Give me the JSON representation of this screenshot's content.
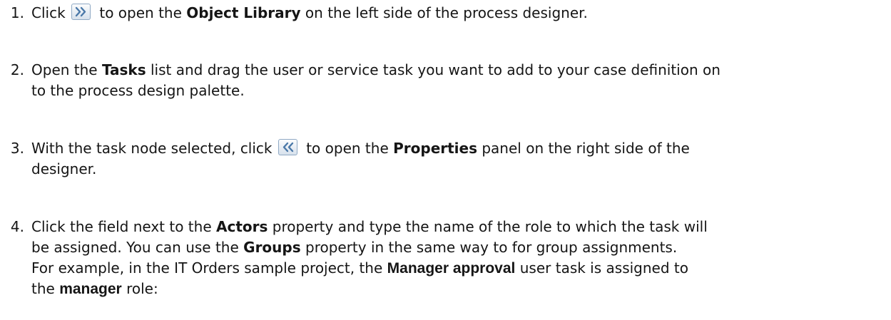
{
  "steps": [
    {
      "number": "1.",
      "lines": [
        {
          "a": "Click ",
          "b": " to open the ",
          "bold": "Object Library",
          "c": " on the left side of the process designer."
        }
      ],
      "icon": "expand-right-double-chevron-icon"
    },
    {
      "number": "2.",
      "lines": [
        {
          "a": "Open the ",
          "bold": "Tasks",
          "c": " list and drag the user or service task you want to add to your case definition on"
        },
        {
          "a": "to the process design palette."
        }
      ]
    },
    {
      "number": "3.",
      "lines": [
        {
          "a": "With the task node selected, click ",
          "b": " to open the ",
          "bold": "Properties",
          "c": " panel on the right side of the"
        },
        {
          "a": "designer."
        }
      ],
      "icon": "collapse-left-double-chevron-icon"
    },
    {
      "number": "4.",
      "lines": [
        {
          "a": "Click the field next to the ",
          "bold": "Actors",
          "c": " property and type the name of the role to which the task will"
        },
        {
          "a": "be assigned. You can use the ",
          "bold": "Groups",
          "c": " property in the same way to for group assignments."
        },
        {
          "a": "For example, in the IT Orders sample project, the ",
          "bold": "Manager approval",
          "c": " user task is assigned to"
        },
        {
          "a": "the ",
          "bold": "manager",
          "c": " role:"
        }
      ]
    }
  ],
  "colors": {
    "text": "#151515",
    "icon_arrow": "#4a78a8",
    "icon_border": "#8fa9c4"
  }
}
